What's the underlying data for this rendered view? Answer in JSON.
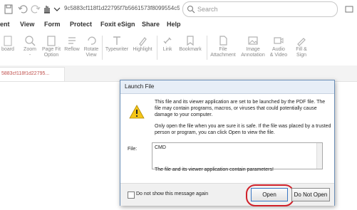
{
  "titlebar": {
    "filename": "9c5883cf118f1d22795f7b5661573f8099554c5a3f78d5...",
    "search_placeholder": "Search"
  },
  "menu": [
    "ent",
    "View",
    "Form",
    "Protect",
    "Foxit eSign",
    "Share",
    "Help"
  ],
  "ribbon": {
    "clipboard": "board",
    "zoom": [
      "Zoom",
      "-"
    ],
    "pagefit": [
      "Page Fit",
      "Option"
    ],
    "reflow": "Reflow",
    "rotate": [
      "Rotate",
      "View"
    ],
    "typewriter": "Typewriter",
    "highlight": "Highlight",
    "link": "Link",
    "bookmark": "Bookmark",
    "fileattach": [
      "File",
      "Attachment"
    ],
    "imageann": [
      "Image",
      "Annotation"
    ],
    "audiovideo": [
      "Audio",
      "& Video"
    ],
    "fillsign": [
      "Fill &",
      "Sign"
    ]
  },
  "doc_tab": "5883cf118f1d22795...",
  "dialog": {
    "title": "Launch File",
    "message_lines": [
      "This file and its viewer application are set to be launched by the PDF file. The",
      "file may contain programs, macros, or viruses that could potentially cause",
      "damage to your computer."
    ],
    "message2_lines": [
      "Only open the file when you are sure it is safe. If the file was placed by a trusted",
      "person or program, you can click Open to view the file."
    ],
    "file_label": "File:",
    "file_value": "CMD",
    "params_text": "The file and its viewer application contain parameters!",
    "checkbox_label": "Do not show this message again",
    "open_label": "Open",
    "not_open_label": "Do Not Open"
  },
  "colors": {
    "accent_red": "#d0212a",
    "dialog_border": "#6b8fb8",
    "warning_yellow": "#f5c518"
  }
}
